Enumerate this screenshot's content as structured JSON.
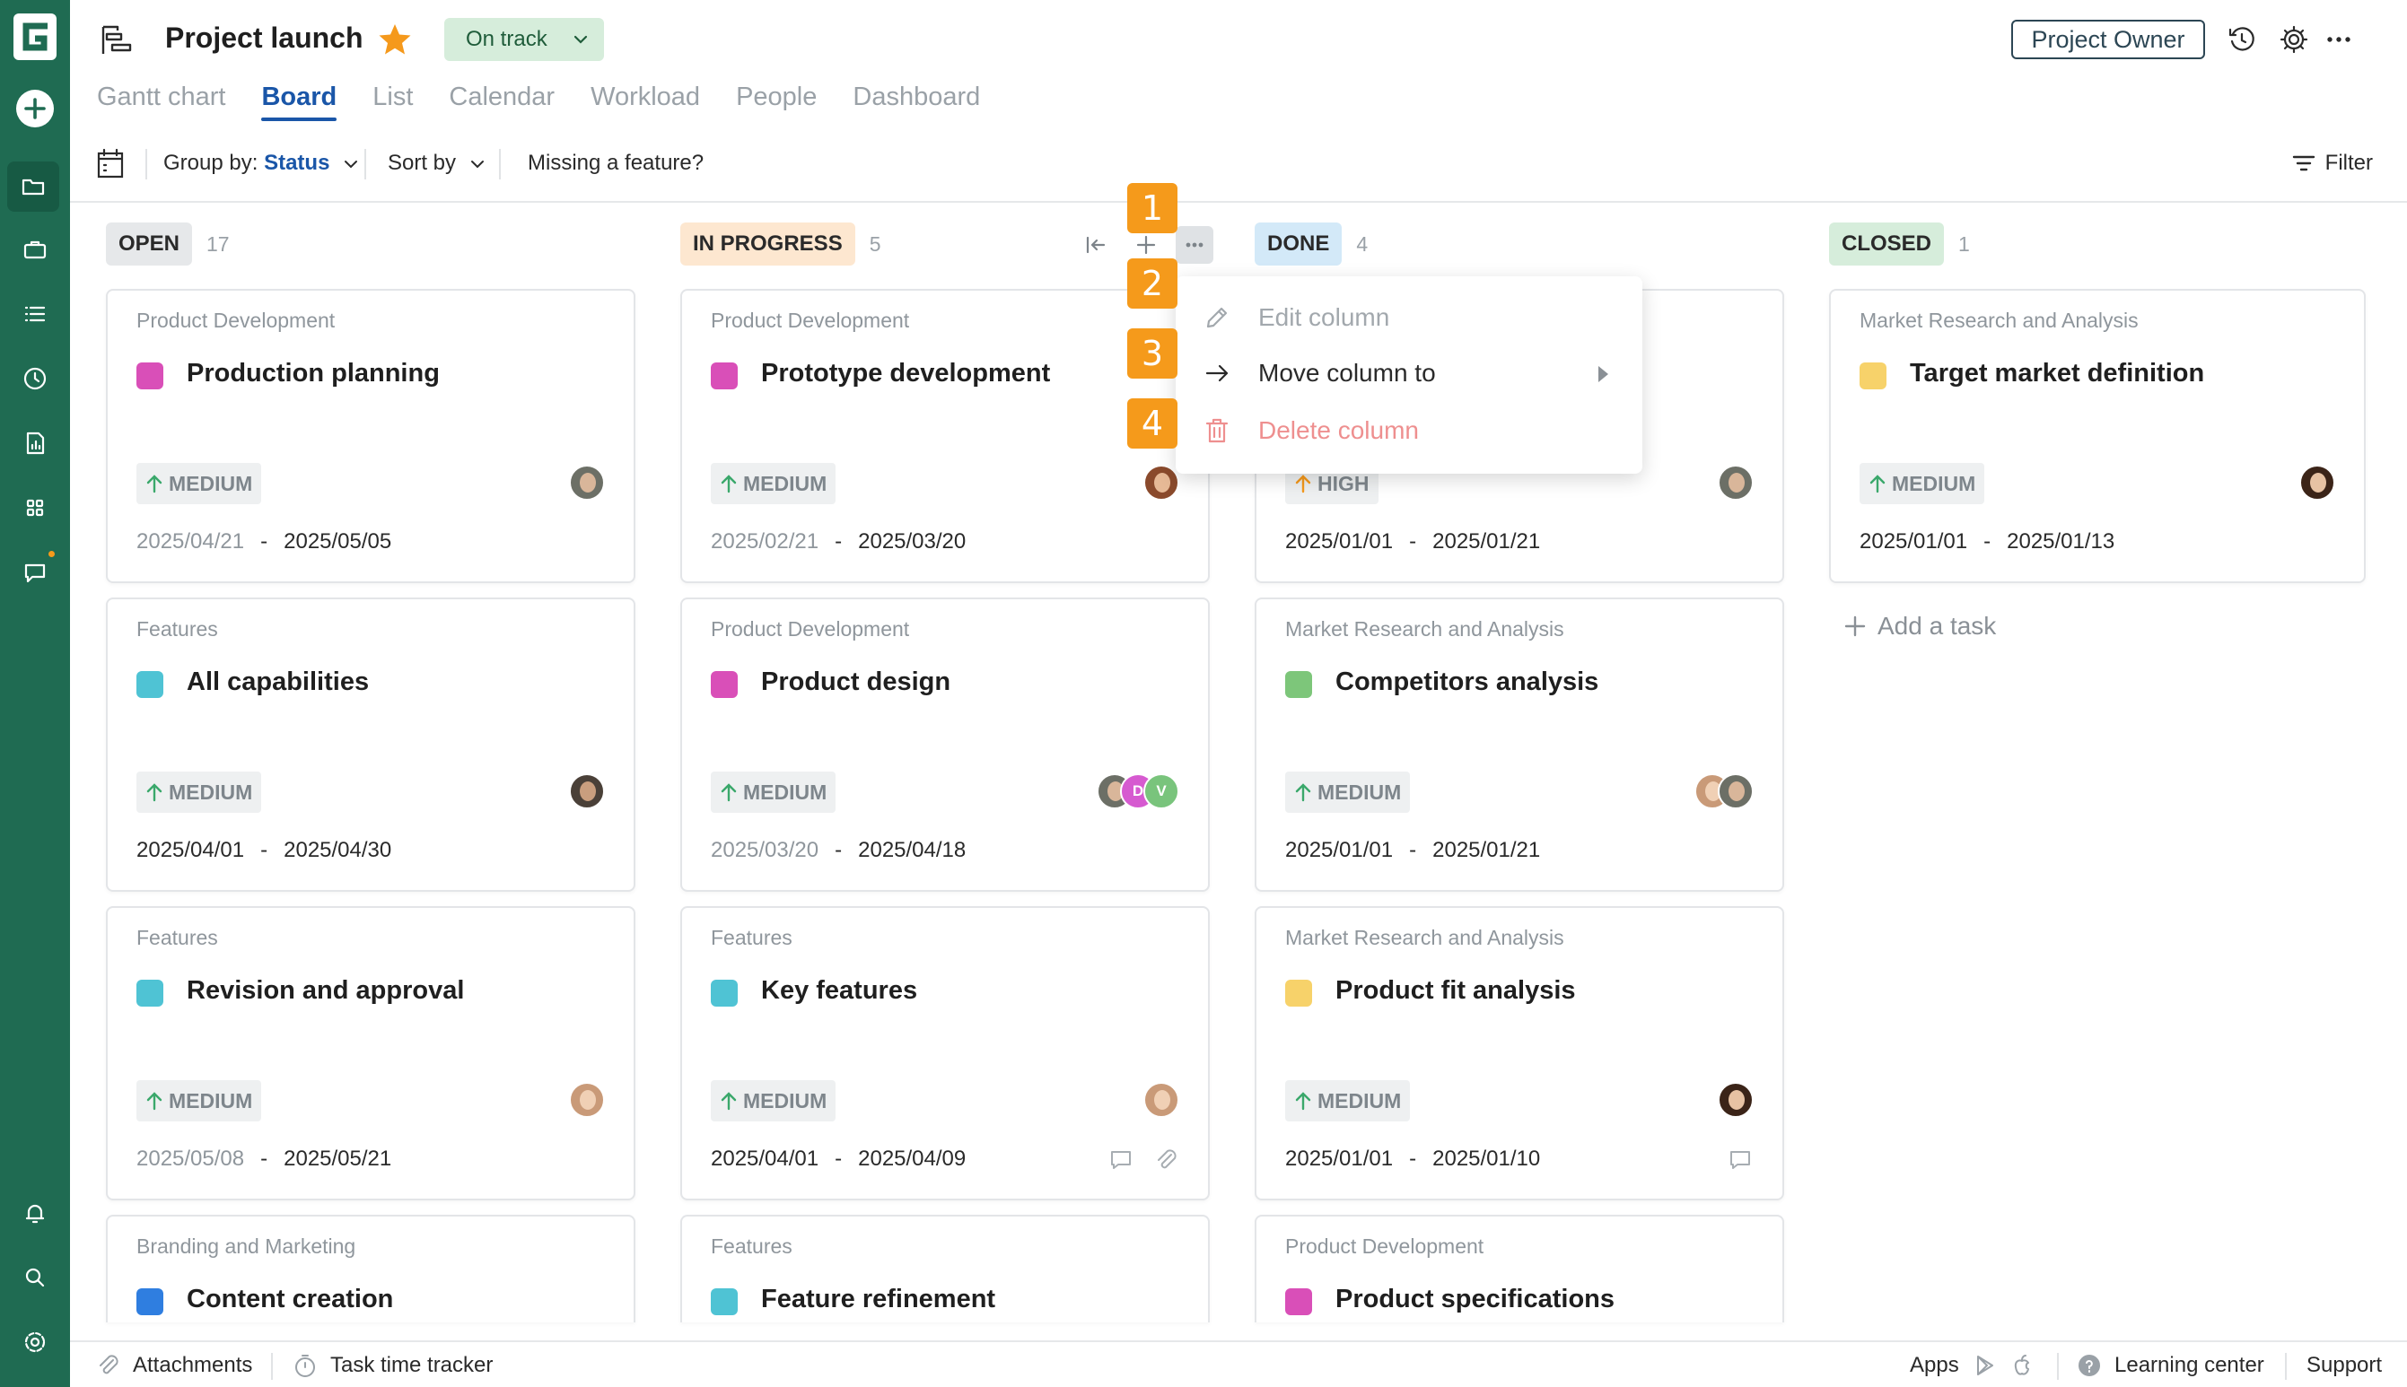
{
  "app": {
    "brand_color": "#1f6b52",
    "accent_color": "#1a56a8",
    "badge_color": "#f59a1b"
  },
  "header": {
    "project_title": "Project launch",
    "favorite": true,
    "status": "On track",
    "role_button": "Project Owner",
    "icons": [
      "history-icon",
      "gear-icon",
      "more-icon"
    ]
  },
  "tabs": [
    {
      "label": "Gantt chart",
      "active": false
    },
    {
      "label": "Board",
      "active": true
    },
    {
      "label": "List",
      "active": false
    },
    {
      "label": "Calendar",
      "active": false
    },
    {
      "label": "Workload",
      "active": false
    },
    {
      "label": "People",
      "active": false
    },
    {
      "label": "Dashboard",
      "active": false
    }
  ],
  "toolbar": {
    "group_by_label": "Group by:",
    "group_by_value": "Status",
    "sort_by": "Sort by",
    "missing_feature": "Missing a feature?",
    "filter": "Filter"
  },
  "columns": [
    {
      "name": "OPEN",
      "count": "17",
      "color": "#e6e8ea",
      "cards": [
        {
          "category": "Product Development",
          "title": "Production planning",
          "color": "#d94fb8",
          "priority": "MEDIUM",
          "start": "2025/04/21",
          "end": "2025/05/05",
          "start_muted": true
        },
        {
          "category": "Features",
          "title": "All capabilities",
          "color": "#4fc3d4",
          "priority": "MEDIUM",
          "start": "2025/04/01",
          "end": "2025/04/30",
          "start_muted": false
        },
        {
          "category": "Features",
          "title": "Revision and approval",
          "color": "#4fc3d4",
          "priority": "MEDIUM",
          "start": "2025/05/08",
          "end": "2025/05/21",
          "start_muted": true
        },
        {
          "category": "Branding and Marketing",
          "title": "Content creation",
          "color": "#2f7ee0"
        }
      ]
    },
    {
      "name": "IN PROGRESS",
      "count": "5",
      "color": "#fde7d0",
      "cards": [
        {
          "category": "Product Development",
          "title": "Prototype development",
          "color": "#d94fb8",
          "priority": "MEDIUM",
          "start": "2025/02/21",
          "end": "2025/03/20",
          "start_muted": true
        },
        {
          "category": "Product Development",
          "title": "Product design",
          "color": "#d94fb8",
          "priority": "MEDIUM",
          "start": "2025/03/20",
          "end": "2025/04/18",
          "start_muted": true,
          "avatar_letters": [
            "D",
            "V"
          ]
        },
        {
          "category": "Features",
          "title": "Key features",
          "color": "#4fc3d4",
          "priority": "MEDIUM",
          "start": "2025/04/01",
          "end": "2025/04/09",
          "start_muted": false
        },
        {
          "category": "Features",
          "title": "Feature refinement",
          "color": "#4fc3d4"
        }
      ]
    },
    {
      "name": "DONE",
      "count": "4",
      "color": "#d3e9f8",
      "cards": [
        {
          "category": "",
          "title": "",
          "color": "",
          "priority": "HIGH",
          "start": "2025/01/01",
          "end": "2025/01/21",
          "start_muted": false
        },
        {
          "category": "Market Research and Analysis",
          "title": "Competitors analysis",
          "color": "#7dc67a",
          "priority": "MEDIUM",
          "start": "2025/01/01",
          "end": "2025/01/21",
          "start_muted": false
        },
        {
          "category": "Market Research and Analysis",
          "title": "Product fit analysis",
          "color": "#f7d26a",
          "priority": "MEDIUM",
          "start": "2025/01/01",
          "end": "2025/01/10",
          "start_muted": false
        },
        {
          "category": "Product Development",
          "title": "Product specifications",
          "color": "#d94fb8"
        }
      ]
    },
    {
      "name": "CLOSED",
      "count": "1",
      "color": "#d6eddb",
      "cards": [
        {
          "category": "Market Research and Analysis",
          "title": "Target market definition",
          "color": "#f7d26a",
          "priority": "MEDIUM",
          "start": "2025/01/01",
          "end": "2025/01/13",
          "start_muted": false
        }
      ],
      "add_task": "Add a task"
    }
  ],
  "column_menu": {
    "items": [
      {
        "label": "Edit column",
        "icon": "pencil-icon",
        "state": "disabled"
      },
      {
        "label": "Move column to",
        "icon": "arrow-right-icon",
        "state": "enabled",
        "submenu": true
      },
      {
        "label": "Delete column",
        "icon": "trash-icon",
        "state": "danger-disabled"
      }
    ]
  },
  "badges": [
    "1",
    "2",
    "3",
    "4"
  ],
  "footer": {
    "attachments": "Attachments",
    "task_time_tracker": "Task time tracker",
    "apps": "Apps",
    "learning_center": "Learning center",
    "support": "Support"
  }
}
